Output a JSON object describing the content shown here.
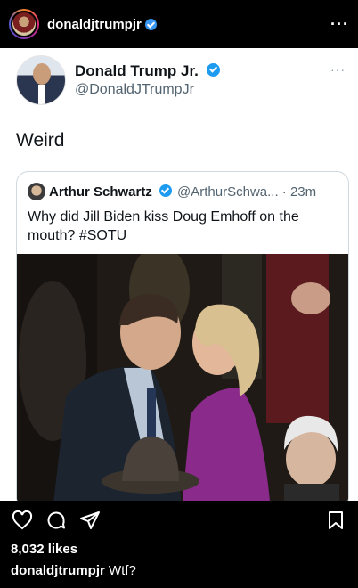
{
  "header": {
    "username": "donaldjtrumpjr",
    "more_label": "···"
  },
  "tweet": {
    "name": "Donald Trump Jr.",
    "handle": "@DonaldJTrumpJr",
    "more_label": "···",
    "text": "Weird",
    "quote": {
      "name": "Arthur Schwartz",
      "handle_time": "@ArthurSchwa... · 23m",
      "text": "Why did Jill Biden kiss Doug Emhoff on the mouth? #SOTU"
    }
  },
  "footer": {
    "likes": "8,032 likes",
    "caption_user": "donaldjtrumpjr",
    "caption_text": "Wtf?"
  },
  "colors": {
    "verified_blue": "#1d9bf0",
    "twitter_text": "#0f1419",
    "twitter_secondary": "#536471",
    "background": "#000000"
  },
  "icons": [
    "verified-icon",
    "heart-icon",
    "comment-icon",
    "share-icon",
    "bookmark-icon",
    "more-icon"
  ]
}
